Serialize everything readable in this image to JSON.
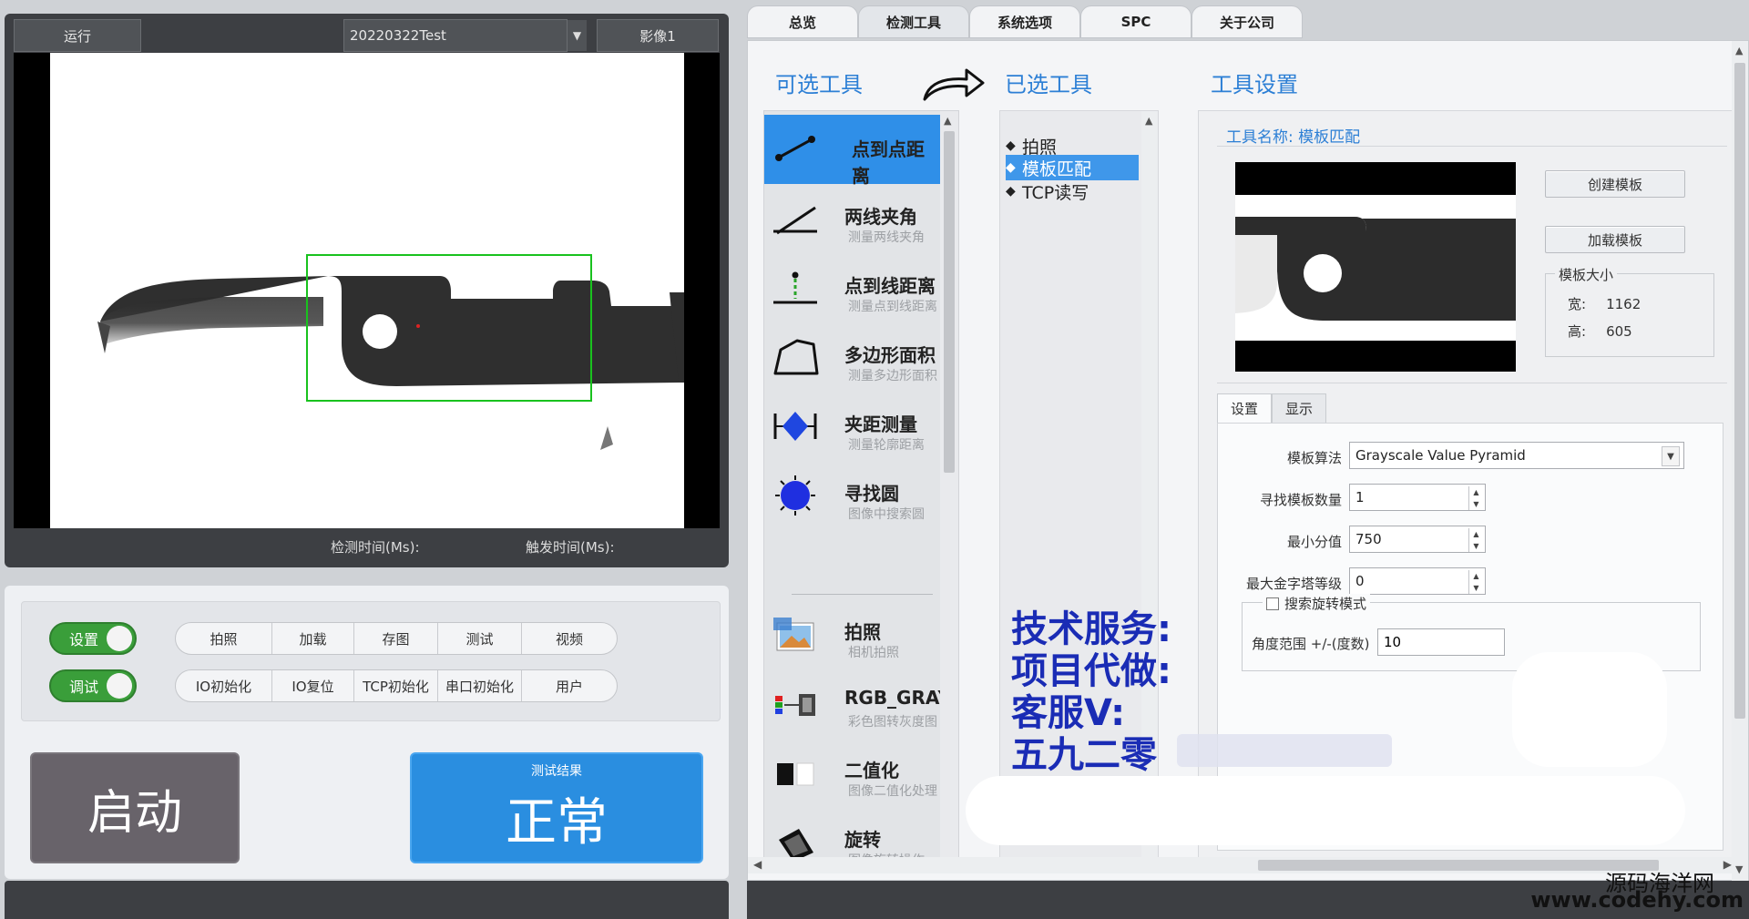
{
  "viewer": {
    "run_label": "运行",
    "project_name": "20220322Test",
    "image_label": "影像1",
    "detect_time_label": "检测时间(Ms):",
    "trigger_time_label": "触发时间(Ms):"
  },
  "controls": {
    "setup_toggle": "设置",
    "debug_toggle": "调试",
    "row1": [
      "拍照",
      "加载",
      "存图",
      "测试",
      "视频"
    ],
    "row2": [
      "IO初始化",
      "IO复位",
      "TCP初始化",
      "串口初始化",
      "用户"
    ],
    "start": "启动",
    "result_label": "测试结果",
    "result_value": "正常"
  },
  "tabs": [
    "总览",
    "检测工具",
    "系统选项",
    "SPC",
    "关于公司"
  ],
  "active_tab": "检测工具",
  "sections": {
    "available": "可选工具",
    "selected": "已选工具",
    "settings": "工具设置"
  },
  "available_tools": [
    {
      "name": "点到点距离",
      "desc": "",
      "icon": "point-distance-icon"
    },
    {
      "name": "两线夹角",
      "desc": "测量两线夹角",
      "icon": "line-angle-icon"
    },
    {
      "name": "点到线距离",
      "desc": "测量点到线距离",
      "icon": "point-line-icon"
    },
    {
      "name": "多边形面积",
      "desc": "测量多边形面积",
      "icon": "polygon-icon"
    },
    {
      "name": "夹距测量",
      "desc": "测量轮廓距离",
      "icon": "caliper-icon"
    },
    {
      "name": "寻找圆",
      "desc": "图像中搜索圆",
      "icon": "circle-icon"
    },
    {
      "name": "拍照",
      "desc": "相机拍照",
      "icon": "photo-icon"
    },
    {
      "name": "RGB_GRAY",
      "desc": "彩色图转灰度图",
      "icon": "rgb-gray-icon"
    },
    {
      "name": "二值化",
      "desc": "图像二值化处理",
      "icon": "binarize-icon"
    },
    {
      "name": "旋转",
      "desc": "图像旋转操作",
      "icon": "rotate-icon"
    }
  ],
  "selected_tools": [
    "拍照",
    "模板匹配",
    "TCP读写"
  ],
  "tool_settings": {
    "name_label": "工具名称:",
    "name_value": "模板匹配",
    "create_template": "创建模板",
    "load_template": "加载模板",
    "size_legend": "模板大小",
    "width_label": "宽:",
    "width_value": "1162",
    "height_label": "高:",
    "height_value": "605",
    "subtabs": [
      "设置",
      "显示"
    ],
    "algorithm_label": "模板算法",
    "algorithm_value": "Grayscale Value Pyramid",
    "count_label": "寻找模板数量",
    "count_value": "1",
    "min_score_label": "最小分值",
    "min_score_value": "750",
    "pyramid_label": "最大金字塔等级",
    "pyramid_value": "0",
    "rotate_mode_label": "搜索旋转模式",
    "angle_label": "角度范围 +/-(度数)",
    "angle_value": "10"
  },
  "overlay": {
    "line1": "技术服务:",
    "line2": "项目代做:",
    "line3": "客服V:",
    "line4": "五九二零"
  },
  "watermark": {
    "line1": "源码海洋网",
    "line2": "www.codehy.com"
  },
  "colors": {
    "accent_blue": "#2f8fe8",
    "title_blue": "#2c7fd5",
    "toggle_green": "#3a9e3a",
    "roi_green": "#19c21e"
  }
}
